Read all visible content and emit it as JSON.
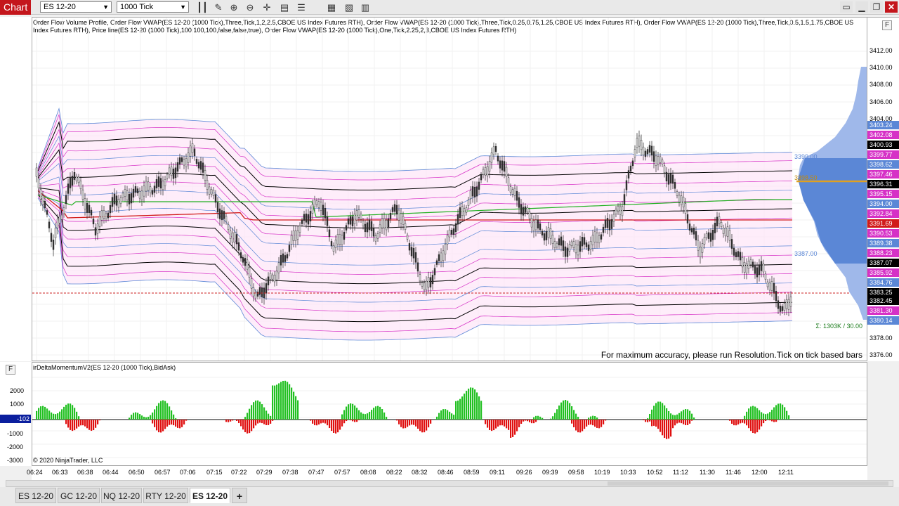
{
  "toolbar": {
    "chart_label": "Chart",
    "instrument": "ES 12-20",
    "bar_type": "1000 Tick",
    "icons": [
      "bars-icon",
      "pencil-icon",
      "zoom-in-icon",
      "zoom-out-icon",
      "crosshair-icon",
      "data-box-icon",
      "properties-icon",
      "indicators-icon",
      "strategies-icon"
    ],
    "window_buttons": [
      "maximize-icon",
      "minimize-icon",
      "restore-icon",
      "close-icon"
    ]
  },
  "price_panel": {
    "legend": "Order Flow Volume Profile, Order Flow VWAP(ES 12-20 (1000 Tick),Three,Tick,1,2,2.5,CBOE US Index Futures RTH), Order Flow VWAP(ES 12-20 (1000 Tick),Three,Tick,0.25,0.75,1.25,CBOE US Index Futures RTH), Order Flow VWAP(ES 12-20 (1000 Tick),Three,Tick,0.5,1.5,1.75,CBOE US Index Futures RTH), Price line(ES 12-20 (1000 Tick),100,100,100,false,false,true), Order Flow VWAP(ES 12-20 (1000 Tick),One,Tick,2.25,2,3,CBOE US Index Futures RTH)",
    "notice": "For maximum accuracy, please run Resolution.Tick on tick based bars",
    "volume_summary": "Σ: 1303K / 30.00",
    "profile_labels": [
      "3399.00",
      "3398.50",
      "3387.00"
    ]
  },
  "price_axis": {
    "ticks": [
      "3412.00",
      "3410.00",
      "3408.00",
      "3406.00",
      "3404.00",
      "3378.00",
      "3376.00"
    ],
    "tags": [
      {
        "value": "3403.24",
        "color": "#5b87d6"
      },
      {
        "value": "3402.08",
        "color": "#d631c6"
      },
      {
        "value": "3400.93",
        "color": "#000000"
      },
      {
        "value": "3399.77",
        "color": "#d631c6"
      },
      {
        "value": "3398.62",
        "color": "#5b87d6"
      },
      {
        "value": "3397.46",
        "color": "#d631c6"
      },
      {
        "value": "3396.31",
        "color": "#000000"
      },
      {
        "value": "3395.15",
        "color": "#d631c6"
      },
      {
        "value": "3394.00",
        "color": "#5b87d6"
      },
      {
        "value": "3392.84",
        "color": "#d631c6"
      },
      {
        "value": "3391.69",
        "color": "#d11a1a"
      },
      {
        "value": "3390.53",
        "color": "#d631c6"
      },
      {
        "value": "3389.38",
        "color": "#5b87d6"
      },
      {
        "value": "3388.23",
        "color": "#d631c6"
      },
      {
        "value": "3387.07",
        "color": "#000000"
      },
      {
        "value": "3385.92",
        "color": "#d631c6"
      },
      {
        "value": "3384.76",
        "color": "#5b87d6"
      },
      {
        "value": "3383.25",
        "color": "#000000"
      },
      {
        "value": "3382.45",
        "color": "#000000"
      },
      {
        "value": "3381.30",
        "color": "#d631c6"
      },
      {
        "value": "3380.14",
        "color": "#5b87d6"
      }
    ]
  },
  "indicator_panel": {
    "title": "irDeltaMomentumV2(ES 12-20 (1000 Tick),BidAsk)",
    "current_value": "-102",
    "ticks": [
      "2000",
      "1000",
      "-1000",
      "-2000",
      "-3000"
    ],
    "copyright": "© 2020 NinjaTrader, LLC"
  },
  "time_axis": {
    "labels": [
      "06:24",
      "06:33",
      "06:38",
      "06:44",
      "06:50",
      "06:57",
      "07:06",
      "07:15",
      "07:22",
      "07:29",
      "07:38",
      "07:47",
      "07:57",
      "08:08",
      "08:22",
      "08:32",
      "08:46",
      "08:59",
      "09:11",
      "09:26",
      "09:39",
      "09:58",
      "10:19",
      "10:33",
      "10:52",
      "11:12",
      "11:30",
      "11:46",
      "12:00",
      "12:11"
    ]
  },
  "tabs": [
    {
      "label": "ES 12-20",
      "active": false
    },
    {
      "label": "GC 12-20",
      "active": false
    },
    {
      "label": "NQ 12-20",
      "active": false
    },
    {
      "label": "RTY 12-20",
      "active": false
    },
    {
      "label": "ES 12-20",
      "active": true
    }
  ],
  "add_tab_label": "+",
  "colors": {
    "vwap_main": "#d11a1a",
    "band_black": "#000000",
    "band_magenta": "#d631c6",
    "band_blue": "#5b87d6",
    "band_green": "#22b022",
    "profile_blue": "#5b87d6",
    "poc": "#e0a020",
    "delta_pos": "#22c022",
    "delta_neg": "#e01010",
    "price_line": "#cc2020"
  }
}
